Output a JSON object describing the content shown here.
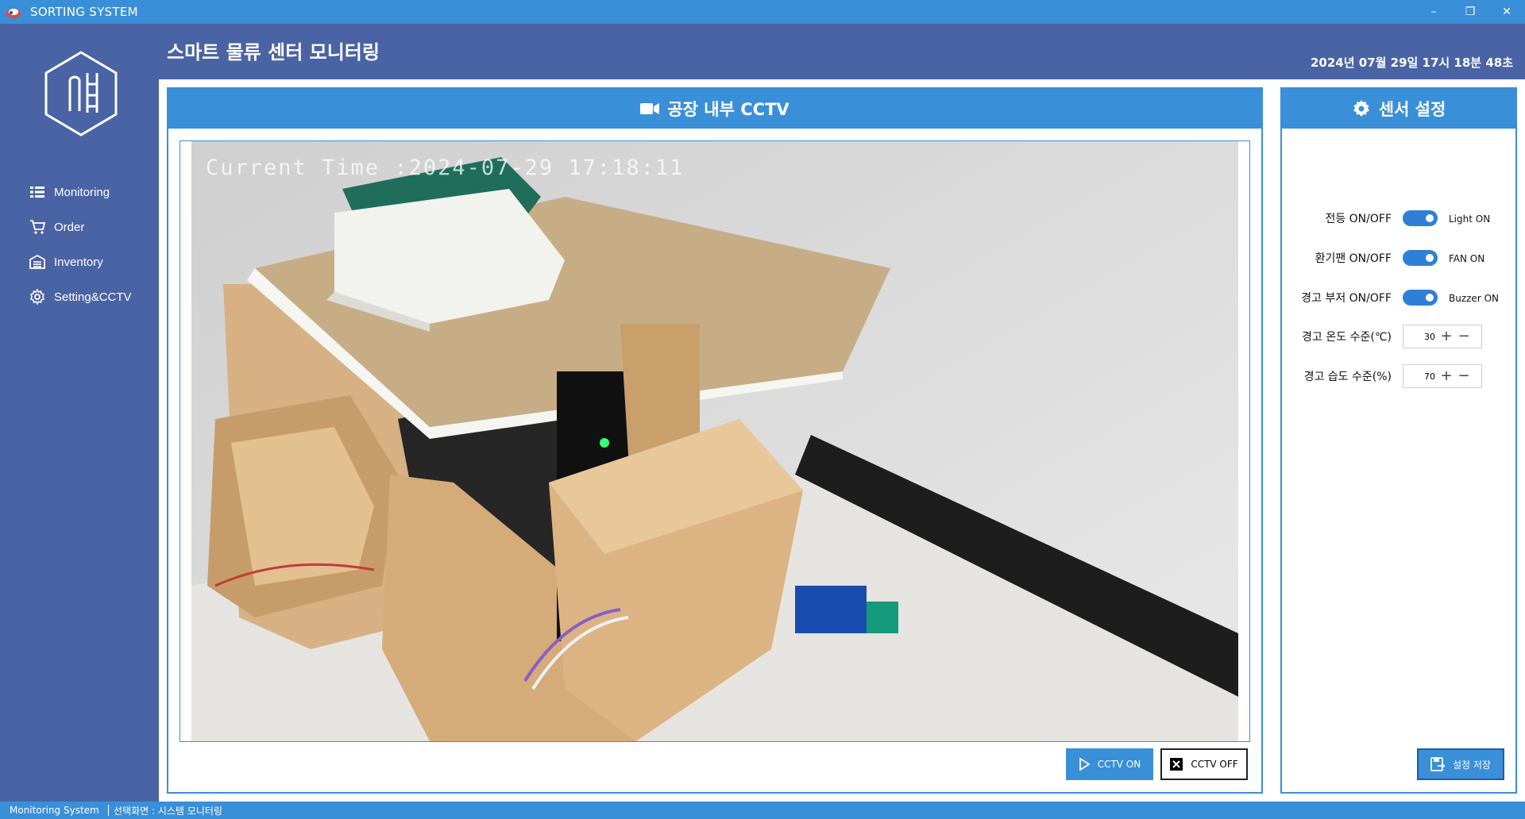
{
  "window": {
    "title": "SORTING SYSTEM",
    "controls": {
      "minimize": "–",
      "restore": "❐",
      "close": "✕"
    }
  },
  "sidebar": {
    "items": [
      {
        "label": "Monitoring",
        "icon": "list-icon"
      },
      {
        "label": "Order",
        "icon": "cart-icon"
      },
      {
        "label": "Inventory",
        "icon": "warehouse-icon"
      },
      {
        "label": "Setting&CCTV",
        "icon": "gear-icon"
      }
    ]
  },
  "header": {
    "title": "스마트 물류 센터 모니터링",
    "datetime": "2024년 07월 29일 17시 18분 48초"
  },
  "cctv": {
    "title": "공장 내부 CCTV",
    "overlay_text": "Current Time :2024-07-29 17:18:11",
    "on_label": "CCTV ON",
    "off_label": "CCTV OFF"
  },
  "sensor": {
    "title": "센서 설정",
    "light": {
      "label": "전등 ON/OFF",
      "state": "Light ON",
      "on": true
    },
    "fan": {
      "label": "환기팬 ON/OFF",
      "state": "FAN ON",
      "on": true
    },
    "buzzer": {
      "label": "경고 부저 ON/OFF",
      "state": "Buzzer ON",
      "on": true
    },
    "temp": {
      "label": "경고 온도 수준(℃)",
      "value": "30"
    },
    "humidity": {
      "label": "경고 습도 수준(%)",
      "value": "70"
    },
    "save_label": "설정 저장"
  },
  "statusbar": {
    "left": "Monitoring System",
    "right": "선택화면 : 시스템 모니터링"
  },
  "colors": {
    "accent": "#3a8fd9",
    "sidebar": "#4a63a4",
    "toggle_on": "#2f7fd6"
  }
}
